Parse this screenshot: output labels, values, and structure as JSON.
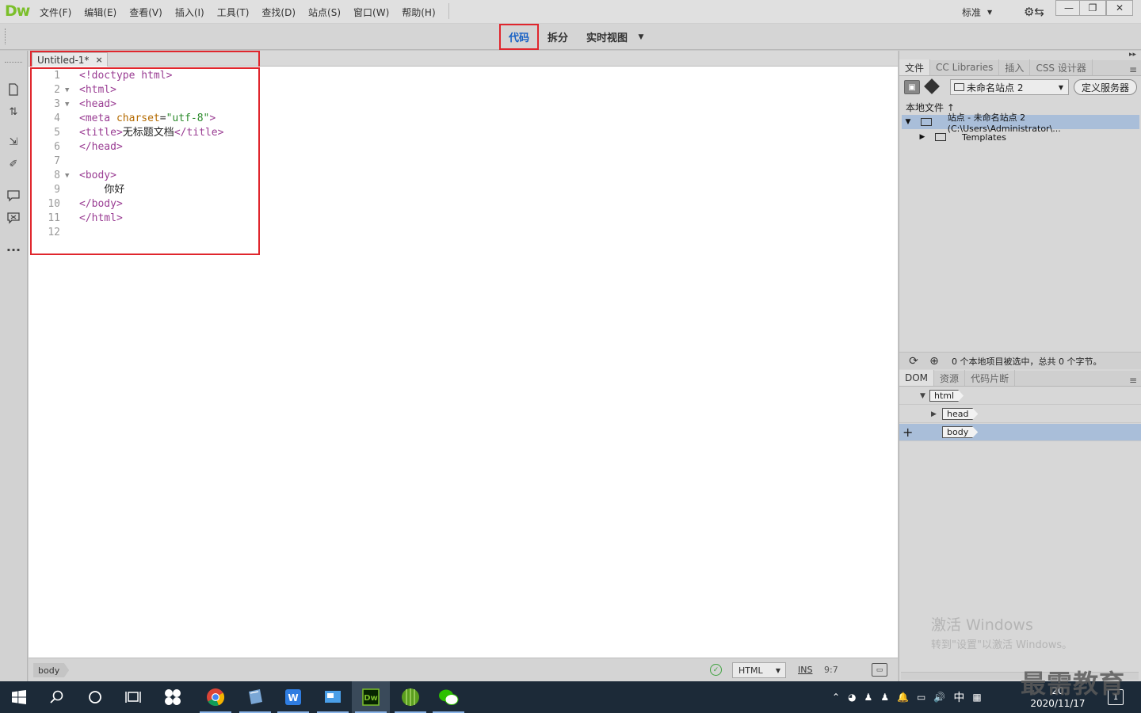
{
  "app": {
    "logo": "Dw",
    "menus": [
      "文件(F)",
      "编辑(E)",
      "查看(V)",
      "插入(I)",
      "工具(T)",
      "查找(D)",
      "站点(S)",
      "窗口(W)",
      "帮助(H)"
    ],
    "workspace": "标准",
    "window_buttons": [
      "—",
      "❐",
      "✕"
    ]
  },
  "view_toolbar": {
    "code_label": "代码",
    "split_label": "拆分",
    "live_label": "实时视图",
    "active_view": "代码",
    "highlight_color": "#e0262d",
    "active_color": "#1560c5"
  },
  "document": {
    "tab_title": "Untitled-1*",
    "tab_close": "×",
    "lines": [
      {
        "num": "1",
        "fold": "",
        "html": "<span class=\"tag\">&lt;!doctype html&gt;</span>",
        "text": "<!doctype html>"
      },
      {
        "num": "2",
        "fold": "▼",
        "html": "<span class=\"tag\">&lt;html&gt;</span>",
        "text": "<html>"
      },
      {
        "num": "3",
        "fold": "▼",
        "html": "<span class=\"tag\">&lt;head&gt;</span>",
        "text": "<head>"
      },
      {
        "num": "4",
        "fold": "",
        "html": "<span class=\"tag\">&lt;meta </span><span class=\"attr\">charset</span>=<span class=\"str\">\"utf-8\"</span><span class=\"tag\">&gt;</span>",
        "text": "<meta charset=\"utf-8\">"
      },
      {
        "num": "5",
        "fold": "",
        "html": "<span class=\"tag\">&lt;title&gt;</span><span class=\"cjk\">无标题文档</span><span class=\"tag\">&lt;/title&gt;</span>",
        "text": "<title>无标题文档</title>"
      },
      {
        "num": "6",
        "fold": "",
        "html": "<span class=\"tag\">&lt;/head&gt;</span>",
        "text": "</head>"
      },
      {
        "num": "7",
        "fold": "",
        "html": "",
        "text": ""
      },
      {
        "num": "8",
        "fold": "▼",
        "html": "<span class=\"tag\">&lt;body&gt;</span>",
        "text": "<body>"
      },
      {
        "num": "9",
        "fold": "",
        "html": "    <span class=\"cjk\">你好</span>",
        "text": "    你好"
      },
      {
        "num": "10",
        "fold": "",
        "html": "<span class=\"tag\">&lt;/body&gt;</span>",
        "text": "</body>"
      },
      {
        "num": "11",
        "fold": "",
        "html": "<span class=\"tag\">&lt;/html&gt;</span>",
        "text": "</html>"
      },
      {
        "num": "12",
        "fold": "",
        "html": "",
        "text": ""
      }
    ]
  },
  "statusbar": {
    "tag": "body",
    "doctype": "HTML",
    "ins": "INS",
    "position": "9:7"
  },
  "files_panel": {
    "tabs": [
      "文件",
      "CC Libraries",
      "插入",
      "CSS 设计器"
    ],
    "site_name": "未命名站点 2",
    "define_server": "定义服务器",
    "local_files": "本地文件 ↑",
    "site_row": "站点 - 未命名站点 2 (C:\\Users\\Administrator\\...",
    "templates_row": "Templates",
    "footer_text": "0 个本地项目被选中，总共 0 个字节。"
  },
  "dom_panel": {
    "tabs": [
      "DOM",
      "资源",
      "代码片断"
    ],
    "nodes": [
      "html",
      "head",
      "body"
    ]
  },
  "watermark": {
    "title": "激活 Windows",
    "subtitle": "转到\"设置\"以激活 Windows。",
    "brand": "最需教育"
  },
  "taskbar": {
    "date": "2020/11/17",
    "time": "20",
    "ime": "中",
    "notifications": "1"
  }
}
